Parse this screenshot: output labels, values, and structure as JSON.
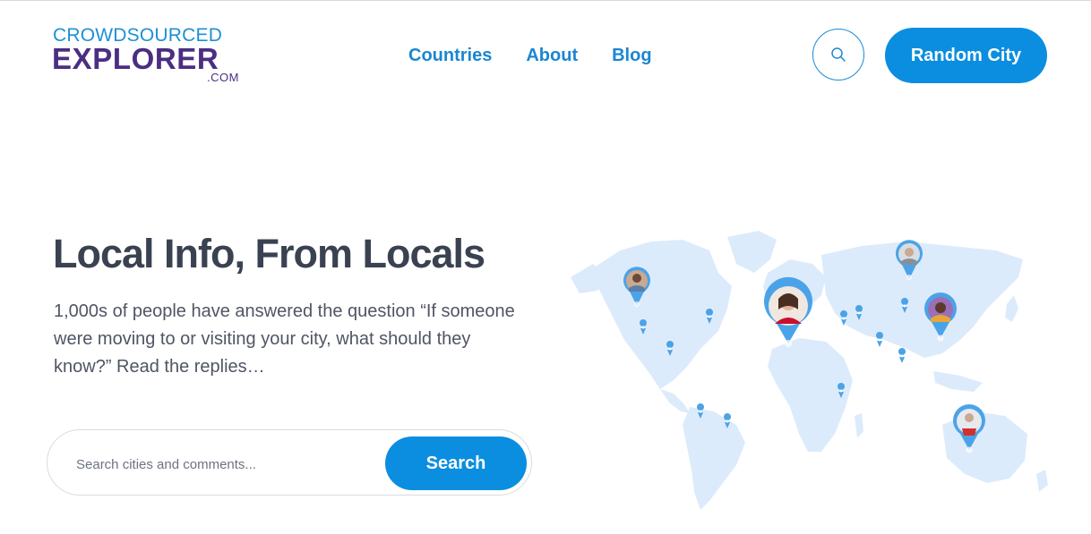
{
  "logo": {
    "line1": "CROWDSOURCED",
    "line2": "EXPLORER",
    "line3": ".COM"
  },
  "nav": {
    "items": [
      "Countries",
      "About",
      "Blog"
    ]
  },
  "header": {
    "random_label": "Random City",
    "search_icon": "search-icon"
  },
  "hero": {
    "title": "Local Info, From Locals",
    "text": "1,000s of people have answered the question “If someone were moving to or visiting your city, what should they know?” Read the replies…"
  },
  "search": {
    "placeholder": "Search cities and comments...",
    "button_label": "Search"
  },
  "colors": {
    "primary": "#0b8ee0",
    "logo_purple": "#4b2e83",
    "map_land": "#dcebfb",
    "pin": "#4aa3e8"
  }
}
